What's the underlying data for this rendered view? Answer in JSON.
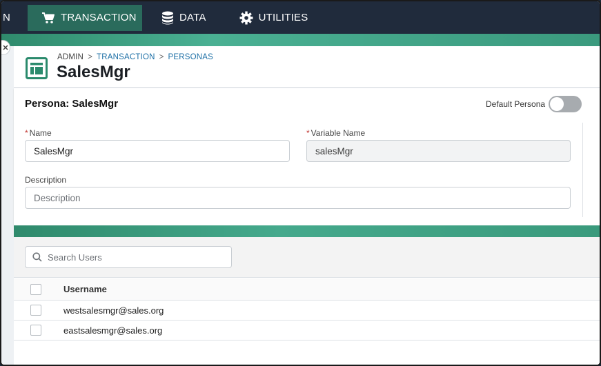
{
  "nav": {
    "cut_label": "N",
    "items": [
      {
        "label": "TRANSACTION",
        "icon": "cart-icon",
        "active": true
      },
      {
        "label": "DATA",
        "icon": "database-icon",
        "active": false
      },
      {
        "label": "UTILITIES",
        "icon": "gear-icon",
        "active": false
      }
    ]
  },
  "header": {
    "breadcrumb": [
      "ADMIN",
      "TRANSACTION",
      "PERSONAS"
    ],
    "title": "SalesMgr",
    "icon": "record-icon"
  },
  "persona": {
    "title": "Persona: SalesMgr",
    "default_label": "Default Persona",
    "default_on": false,
    "name_label": "Name",
    "name_value": "SalesMgr",
    "variable_label": "Variable Name",
    "variable_value": "salesMgr",
    "description_label": "Description",
    "description_placeholder": "Description"
  },
  "users": {
    "search_placeholder": "Search Users",
    "column_username": "Username",
    "rows": [
      {
        "username": "westsalesmgr@sales.org"
      },
      {
        "username": "eastsalesmgr@sales.org"
      }
    ]
  },
  "colors": {
    "nav_bg": "#202b3c",
    "nav_active": "#2a6b5c",
    "accent_green": "#3b9a7e",
    "link": "#1c6fa6",
    "required": "#c23934"
  }
}
